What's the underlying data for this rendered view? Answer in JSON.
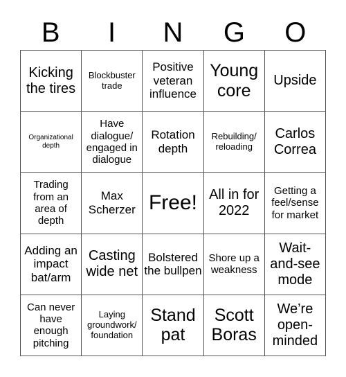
{
  "header": {
    "letters": [
      "B",
      "I",
      "N",
      "G",
      "O"
    ]
  },
  "cells": [
    {
      "text": "Kicking the tires",
      "size": "s-xl"
    },
    {
      "text": "Blockbuster trade",
      "size": "s-sm"
    },
    {
      "text": "Positive veteran influence",
      "size": "s-lg"
    },
    {
      "text": "Young core",
      "size": "s-xxl"
    },
    {
      "text": "Upside",
      "size": "s-xl"
    },
    {
      "text": "Organizational depth",
      "size": "s-xs"
    },
    {
      "text": "Have dialogue/ engaged in dialogue",
      "size": "s-md"
    },
    {
      "text": "Rotation depth",
      "size": "s-lg"
    },
    {
      "text": "Rebuilding/ reloading",
      "size": "s-sm"
    },
    {
      "text": "Carlos Correa",
      "size": "s-xl"
    },
    {
      "text": "Trading from an area of depth",
      "size": "s-md"
    },
    {
      "text": "Max Scherzer",
      "size": "s-lg"
    },
    {
      "text": "Free!",
      "size": "s-free"
    },
    {
      "text": "All in for 2022",
      "size": "s-xl"
    },
    {
      "text": "Getting a feel/sense for market",
      "size": "s-md"
    },
    {
      "text": "Adding an impact bat/arm",
      "size": "s-lg"
    },
    {
      "text": "Casting wide net",
      "size": "s-xl"
    },
    {
      "text": "Bolstered the bullpen",
      "size": "s-lg"
    },
    {
      "text": "Shore up a weakness",
      "size": "s-md"
    },
    {
      "text": "Wait-and-see mode",
      "size": "s-xl"
    },
    {
      "text": "Can never have enough pitching",
      "size": "s-md"
    },
    {
      "text": "Laying groundwork/ foundation",
      "size": "s-sm"
    },
    {
      "text": "Stand pat",
      "size": "s-xxl"
    },
    {
      "text": "Scott Boras",
      "size": "s-xxl"
    },
    {
      "text": "We’re open-minded",
      "size": "s-xl"
    }
  ]
}
